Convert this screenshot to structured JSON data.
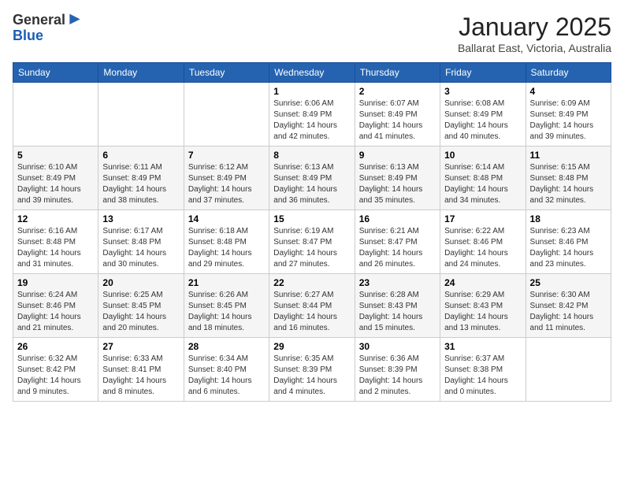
{
  "header": {
    "logo_general": "General",
    "logo_blue": "Blue",
    "month_title": "January 2025",
    "location": "Ballarat East, Victoria, Australia"
  },
  "days_of_week": [
    "Sunday",
    "Monday",
    "Tuesday",
    "Wednesday",
    "Thursday",
    "Friday",
    "Saturday"
  ],
  "weeks": [
    [
      {
        "day": "",
        "info": ""
      },
      {
        "day": "",
        "info": ""
      },
      {
        "day": "",
        "info": ""
      },
      {
        "day": "1",
        "info": "Sunrise: 6:06 AM\nSunset: 8:49 PM\nDaylight: 14 hours\nand 42 minutes."
      },
      {
        "day": "2",
        "info": "Sunrise: 6:07 AM\nSunset: 8:49 PM\nDaylight: 14 hours\nand 41 minutes."
      },
      {
        "day": "3",
        "info": "Sunrise: 6:08 AM\nSunset: 8:49 PM\nDaylight: 14 hours\nand 40 minutes."
      },
      {
        "day": "4",
        "info": "Sunrise: 6:09 AM\nSunset: 8:49 PM\nDaylight: 14 hours\nand 39 minutes."
      }
    ],
    [
      {
        "day": "5",
        "info": "Sunrise: 6:10 AM\nSunset: 8:49 PM\nDaylight: 14 hours\nand 39 minutes."
      },
      {
        "day": "6",
        "info": "Sunrise: 6:11 AM\nSunset: 8:49 PM\nDaylight: 14 hours\nand 38 minutes."
      },
      {
        "day": "7",
        "info": "Sunrise: 6:12 AM\nSunset: 8:49 PM\nDaylight: 14 hours\nand 37 minutes."
      },
      {
        "day": "8",
        "info": "Sunrise: 6:13 AM\nSunset: 8:49 PM\nDaylight: 14 hours\nand 36 minutes."
      },
      {
        "day": "9",
        "info": "Sunrise: 6:13 AM\nSunset: 8:49 PM\nDaylight: 14 hours\nand 35 minutes."
      },
      {
        "day": "10",
        "info": "Sunrise: 6:14 AM\nSunset: 8:48 PM\nDaylight: 14 hours\nand 34 minutes."
      },
      {
        "day": "11",
        "info": "Sunrise: 6:15 AM\nSunset: 8:48 PM\nDaylight: 14 hours\nand 32 minutes."
      }
    ],
    [
      {
        "day": "12",
        "info": "Sunrise: 6:16 AM\nSunset: 8:48 PM\nDaylight: 14 hours\nand 31 minutes."
      },
      {
        "day": "13",
        "info": "Sunrise: 6:17 AM\nSunset: 8:48 PM\nDaylight: 14 hours\nand 30 minutes."
      },
      {
        "day": "14",
        "info": "Sunrise: 6:18 AM\nSunset: 8:48 PM\nDaylight: 14 hours\nand 29 minutes."
      },
      {
        "day": "15",
        "info": "Sunrise: 6:19 AM\nSunset: 8:47 PM\nDaylight: 14 hours\nand 27 minutes."
      },
      {
        "day": "16",
        "info": "Sunrise: 6:21 AM\nSunset: 8:47 PM\nDaylight: 14 hours\nand 26 minutes."
      },
      {
        "day": "17",
        "info": "Sunrise: 6:22 AM\nSunset: 8:46 PM\nDaylight: 14 hours\nand 24 minutes."
      },
      {
        "day": "18",
        "info": "Sunrise: 6:23 AM\nSunset: 8:46 PM\nDaylight: 14 hours\nand 23 minutes."
      }
    ],
    [
      {
        "day": "19",
        "info": "Sunrise: 6:24 AM\nSunset: 8:46 PM\nDaylight: 14 hours\nand 21 minutes."
      },
      {
        "day": "20",
        "info": "Sunrise: 6:25 AM\nSunset: 8:45 PM\nDaylight: 14 hours\nand 20 minutes."
      },
      {
        "day": "21",
        "info": "Sunrise: 6:26 AM\nSunset: 8:45 PM\nDaylight: 14 hours\nand 18 minutes."
      },
      {
        "day": "22",
        "info": "Sunrise: 6:27 AM\nSunset: 8:44 PM\nDaylight: 14 hours\nand 16 minutes."
      },
      {
        "day": "23",
        "info": "Sunrise: 6:28 AM\nSunset: 8:43 PM\nDaylight: 14 hours\nand 15 minutes."
      },
      {
        "day": "24",
        "info": "Sunrise: 6:29 AM\nSunset: 8:43 PM\nDaylight: 14 hours\nand 13 minutes."
      },
      {
        "day": "25",
        "info": "Sunrise: 6:30 AM\nSunset: 8:42 PM\nDaylight: 14 hours\nand 11 minutes."
      }
    ],
    [
      {
        "day": "26",
        "info": "Sunrise: 6:32 AM\nSunset: 8:42 PM\nDaylight: 14 hours\nand 9 minutes."
      },
      {
        "day": "27",
        "info": "Sunrise: 6:33 AM\nSunset: 8:41 PM\nDaylight: 14 hours\nand 8 minutes."
      },
      {
        "day": "28",
        "info": "Sunrise: 6:34 AM\nSunset: 8:40 PM\nDaylight: 14 hours\nand 6 minutes."
      },
      {
        "day": "29",
        "info": "Sunrise: 6:35 AM\nSunset: 8:39 PM\nDaylight: 14 hours\nand 4 minutes."
      },
      {
        "day": "30",
        "info": "Sunrise: 6:36 AM\nSunset: 8:39 PM\nDaylight: 14 hours\nand 2 minutes."
      },
      {
        "day": "31",
        "info": "Sunrise: 6:37 AM\nSunset: 8:38 PM\nDaylight: 14 hours\nand 0 minutes."
      },
      {
        "day": "",
        "info": ""
      }
    ]
  ]
}
